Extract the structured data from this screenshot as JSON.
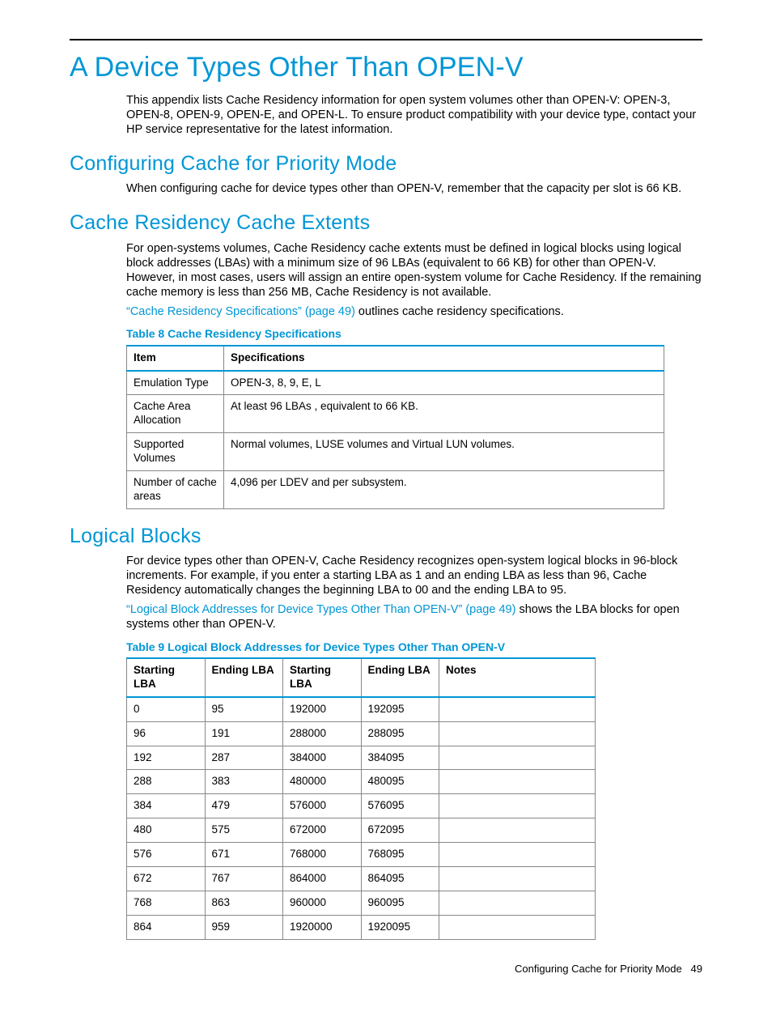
{
  "page_title": "A Device Types Other Than OPEN-V",
  "intro": "This appendix lists Cache Residency information for open system volumes other than OPEN-V: OPEN-3, OPEN-8, OPEN-9, OPEN-E, and OPEN-L. To ensure product compatibility with your device type, contact your HP service representative for the latest information.",
  "section1": {
    "heading": "Configuring Cache for Priority Mode",
    "body": "When configuring cache for device types other than OPEN-V, remember that the capacity per slot is 66 KB."
  },
  "section2": {
    "heading": "Cache Residency Cache Extents",
    "body": "For open-systems volumes, Cache Residency cache extents must be defined in logical blocks using logical block addresses (LBAs) with a minimum size of 96 LBAs (equivalent to 66 KB) for other than OPEN-V. However, in most cases, users will assign an entire open-system volume for Cache Residency. If the remaining cache memory is less than 256 MB, Cache Residency is not available.",
    "linktext": "“Cache Residency Specifications” (page 49)",
    "linktail": " outlines cache residency specifications."
  },
  "table8": {
    "caption": "Table 8 Cache Residency Specifications",
    "headers": [
      "Item",
      "Specifications"
    ],
    "rows": [
      [
        "Emulation Type",
        "OPEN-3, 8, 9, E, L"
      ],
      [
        "Cache Area Allocation",
        "At least 96 LBAs , equivalent to 66 KB."
      ],
      [
        "Supported Volumes",
        "Normal volumes, LUSE volumes and Virtual LUN volumes."
      ],
      [
        "Number of cache areas",
        "4,096 per LDEV and per subsystem."
      ]
    ]
  },
  "section3": {
    "heading": "Logical Blocks",
    "body": "For device types other than OPEN-V, Cache Residency recognizes open-system logical blocks in 96-block increments. For example, if you enter a starting LBA as 1 and an ending LBA as less than 96, Cache Residency automatically changes the beginning LBA to 00 and the ending LBA to 95.",
    "linktext": "“Logical Block Addresses for Device Types Other Than OPEN-V” (page 49)",
    "linktail": " shows the LBA blocks for open systems other than OPEN-V."
  },
  "table9": {
    "caption": "Table 9 Logical Block Addresses for Device Types Other Than OPEN-V",
    "headers": [
      "Starting LBA",
      "Ending LBA",
      "Starting LBA",
      "Ending LBA",
      "Notes"
    ],
    "rows": [
      [
        "0",
        "95",
        "192000",
        "192095",
        ""
      ],
      [
        "96",
        "191",
        "288000",
        "288095",
        ""
      ],
      [
        "192",
        "287",
        "384000",
        "384095",
        ""
      ],
      [
        "288",
        "383",
        "480000",
        "480095",
        ""
      ],
      [
        "384",
        "479",
        "576000",
        "576095",
        ""
      ],
      [
        "480",
        "575",
        "672000",
        "672095",
        ""
      ],
      [
        "576",
        "671",
        "768000",
        "768095",
        ""
      ],
      [
        "672",
        "767",
        "864000",
        "864095",
        ""
      ],
      [
        "768",
        "863",
        "960000",
        "960095",
        ""
      ],
      [
        "864",
        "959",
        "1920000",
        "1920095",
        ""
      ]
    ]
  },
  "footer": {
    "text": "Configuring Cache for Priority Mode",
    "page": "49"
  }
}
